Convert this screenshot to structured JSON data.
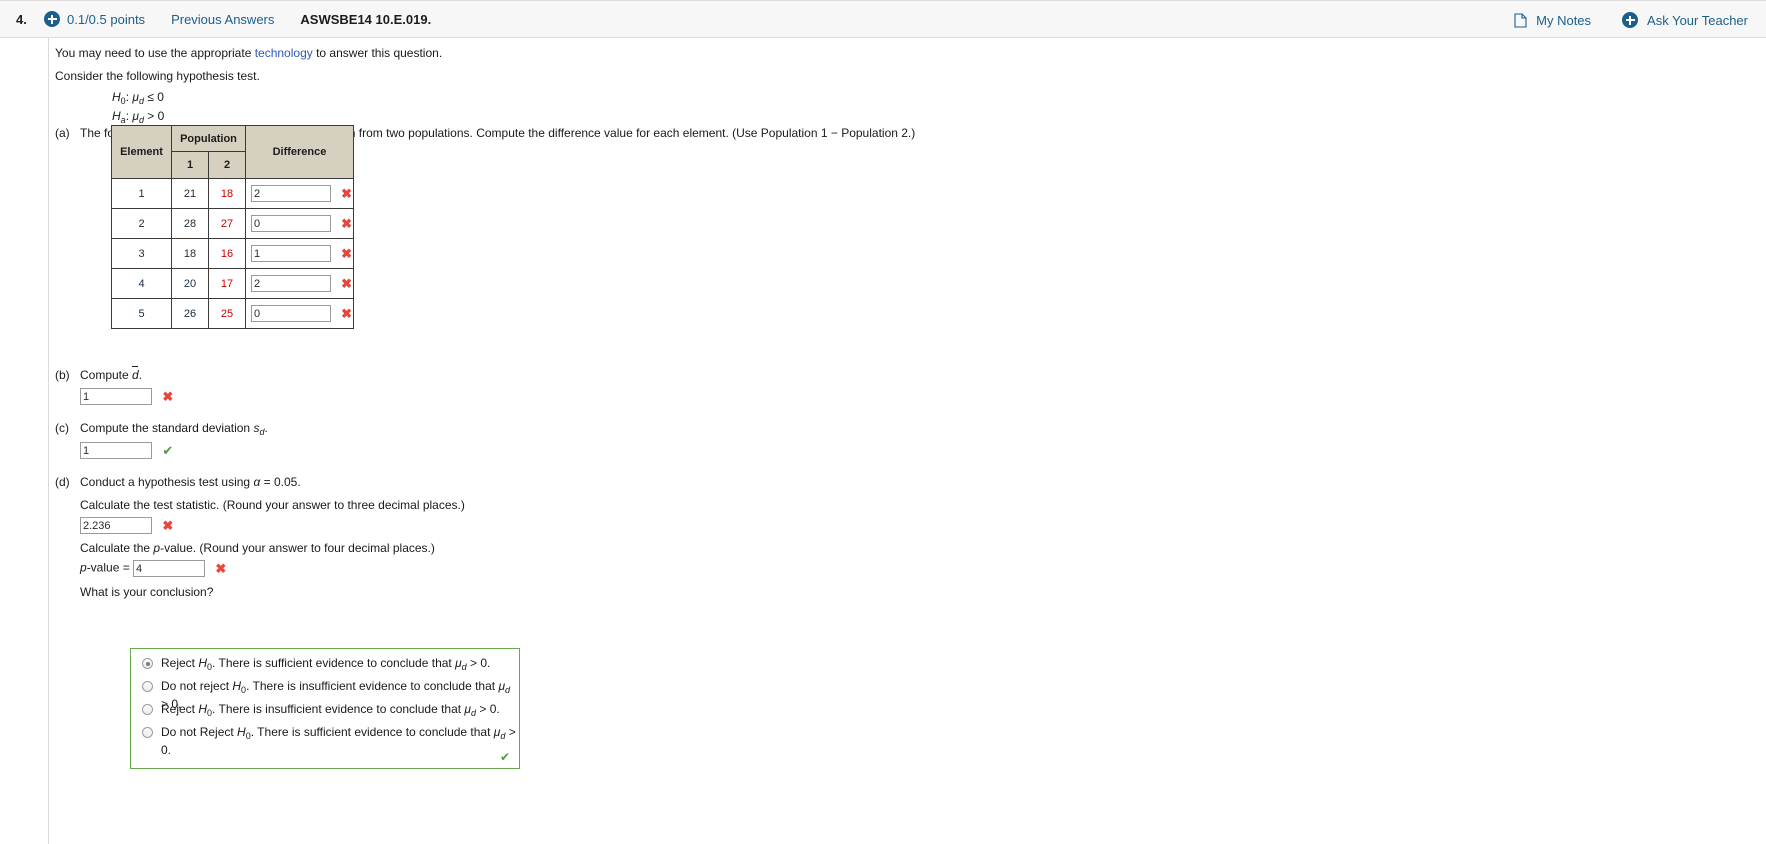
{
  "header": {
    "question_number": "4.",
    "points": "0.1/0.5 points",
    "previous_answers": "Previous Answers",
    "problem_id": "ASWSBE14 10.E.019.",
    "my_notes": "My Notes",
    "ask_teacher": "Ask Your Teacher",
    "accent_color": "#1b5f8c"
  },
  "intro": {
    "line1_pre": "You may need to use the appropriate ",
    "line1_link": "technology",
    "line1_post": " to answer this question.",
    "line2": "Consider the following hypothesis test.",
    "hypothesis_null": "H0: μd ≤ 0",
    "hypothesis_alt": "Ha: μd > 0"
  },
  "parts": {
    "a": {
      "label": "(a)",
      "text": "The following data are from matched samples taken from two populations. Compute the difference value for each element. (Use Population 1 − Population 2.)",
      "table": {
        "group_header": "Population",
        "headers": [
          "Element",
          "1",
          "2",
          "Difference"
        ],
        "rows": [
          {
            "element": "1",
            "pop1": "21",
            "pop2": "18",
            "difference": "2",
            "mark": "incorrect"
          },
          {
            "element": "2",
            "pop1": "28",
            "pop2": "27",
            "difference": "0",
            "mark": "incorrect"
          },
          {
            "element": "3",
            "pop1": "18",
            "pop2": "16",
            "difference": "1",
            "mark": "incorrect"
          },
          {
            "element": "4",
            "pop1": "20",
            "pop2": "17",
            "difference": "2",
            "mark": "incorrect"
          },
          {
            "element": "5",
            "pop1": "26",
            "pop2": "25",
            "difference": "0",
            "mark": "incorrect"
          }
        ]
      }
    },
    "b": {
      "label": "(b)",
      "text_pre": "Compute ",
      "text_var": "d",
      "text_post": ".",
      "value": "1",
      "mark": "incorrect"
    },
    "c": {
      "label": "(c)",
      "text_pre": "Compute the standard deviation ",
      "text_var": "s",
      "text_sub": "d",
      "text_post": ".",
      "value": "1",
      "mark": "correct"
    },
    "d": {
      "label": "(d)",
      "text_pre": "Conduct a hypothesis test using ",
      "text_alpha": "α",
      "text_post": " = 0.05.",
      "test_statistic_prompt": "Calculate the test statistic. (Round your answer to three decimal places.)",
      "test_statistic_value": "2.236",
      "test_statistic_mark": "incorrect",
      "pvalue_prompt_pre": "Calculate the ",
      "pvalue_prompt_var": "p",
      "pvalue_prompt_post": "-value. (Round your answer to four decimal places.)",
      "pvalue_label_var": "p",
      "pvalue_label_post": "-value = ",
      "pvalue_value": "4",
      "pvalue_mark": "incorrect",
      "conclusion_prompt": "What is your conclusion?",
      "choices": [
        {
          "selected": true,
          "pre": "Reject ",
          "h": "H",
          "hsub": "0",
          "mid": ". There is sufficient evidence to conclude that ",
          "mu": "μ",
          "musub": "d",
          "post": " > 0."
        },
        {
          "selected": false,
          "pre": "Do not reject ",
          "h": "H",
          "hsub": "0",
          "mid": ". There is insufficient evidence to conclude that ",
          "mu": "μ",
          "musub": "d",
          "post": " > 0."
        },
        {
          "selected": false,
          "pre": "Reject ",
          "h": "H",
          "hsub": "0",
          "mid": ". There is insufficient evidence to conclude that ",
          "mu": "μ",
          "musub": "d",
          "post": " > 0."
        },
        {
          "selected": false,
          "pre": "Do not Reject ",
          "h": "H",
          "hsub": "0",
          "mid": ". There is sufficient evidence to conclude that ",
          "mu": "μ",
          "musub": "d",
          "post": " > 0."
        }
      ],
      "choices_mark": "correct"
    }
  },
  "symbols": {
    "x_mark": "✖",
    "check_mark": "✔"
  }
}
